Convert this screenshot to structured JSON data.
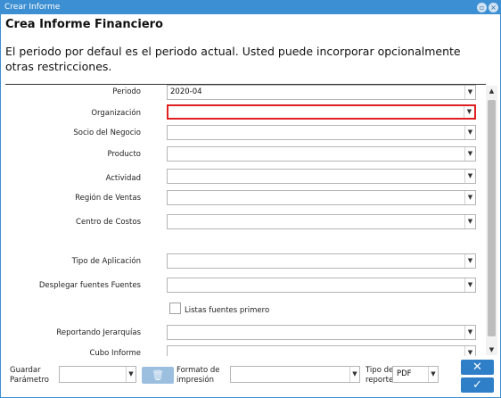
{
  "window": {
    "title": "Crear Informe",
    "maximize_icon": "maximize-icon",
    "close_icon": "close-icon"
  },
  "header": {
    "title": "Crea Informe Financiero",
    "description": "El periodo por defaul es el periodo actual. Usted puede incorporar opcionalmente otras restricciones."
  },
  "fields": {
    "periodo": {
      "label": "Periodo",
      "value": "2020-04"
    },
    "organizacion": {
      "label": "Organización",
      "value": ""
    },
    "socio": {
      "label": "Socio del Negocio",
      "value": ""
    },
    "producto": {
      "label": "Producto",
      "value": ""
    },
    "actividad": {
      "label": "Actividad",
      "value": ""
    },
    "region": {
      "label": "Región de Ventas",
      "value": ""
    },
    "centro": {
      "label": "Centro de Costos",
      "value": ""
    },
    "tipo_aplicacion": {
      "label": "Tipo de Aplicación",
      "value": ""
    },
    "desplegar": {
      "label": "Desplegar fuentes Fuentes",
      "value": ""
    },
    "listas": {
      "label": "Listas fuentes primero",
      "checked": false
    },
    "jerarquias": {
      "label": "Reportando Jerarquías",
      "value": ""
    },
    "cubo": {
      "label": "Cubo Informe",
      "value": ""
    }
  },
  "footer": {
    "guardar_label_1": "Guardar",
    "guardar_label_2": "Parámetro",
    "guardar_value": "",
    "formato_label_1": "Formato de",
    "formato_label_2": "impresión",
    "formato_value": "",
    "tipo_label_1": "Tipo de",
    "tipo_label_2": "reporte",
    "tipo_value": "PDF",
    "cancel_glyph": "✕",
    "ok_glyph": "✓",
    "delete_glyph": "🗑"
  },
  "colors": {
    "accent": "#3c8fd2",
    "button": "#2f7fc8",
    "focus_border": "#e02020"
  }
}
